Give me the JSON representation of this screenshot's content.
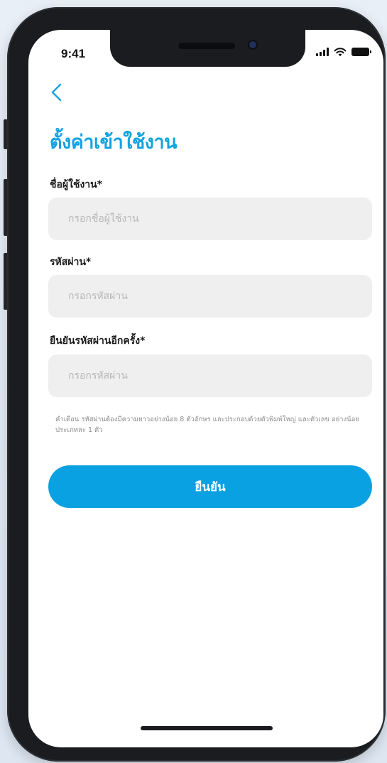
{
  "status_bar": {
    "time": "9:41"
  },
  "page": {
    "title": "ตั้งค่าเข้าใช้งาน"
  },
  "form": {
    "username": {
      "label": "ชื่อผู้ใช้งาน*",
      "placeholder": "กรอกชื่อผู้ใช้งาน",
      "value": ""
    },
    "password": {
      "label": "รหัสผ่าน*",
      "placeholder": "กรอกรหัสผ่าน",
      "value": ""
    },
    "confirm_password": {
      "label": "ยืนยันรหัสผ่านอีกครั้ง*",
      "placeholder": "กรอกรหัสผ่าน",
      "value": ""
    },
    "hint": "คำเตือน รหัสผ่านต้องมีความยาวอย่างน้อย 8 ตัวอักษร และประกอบด้วยตัวพิมพ์ใหญ่ และตัวเลข อย่างน้อยประเภทละ 1 ตัว",
    "submit_label": "ยืนยัน"
  },
  "colors": {
    "accent": "#0aa1e2",
    "title": "#13a3e0",
    "input_bg": "#efefef",
    "frame": "#1a1c20"
  },
  "icons": {
    "back": "chevron-left-icon",
    "signal": "cellular-signal-icon",
    "wifi": "wifi-icon",
    "battery": "battery-icon"
  }
}
